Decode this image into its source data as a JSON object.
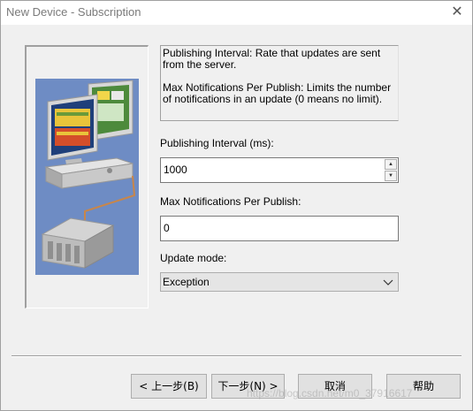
{
  "window": {
    "title": "New Device - Subscription",
    "close_glyph": "✕"
  },
  "description": {
    "line1": "Publishing Interval: Rate that updates are sent from the server.",
    "line2": "Max Notifications Per Publish: Limits the number of notifications in an update (0 means no limit)."
  },
  "publishing_interval": {
    "label": "Publishing Interval (ms):",
    "value": "1000"
  },
  "max_notifications": {
    "label": "Max Notifications Per Publish:",
    "value": "0"
  },
  "update_mode": {
    "label": "Update mode:",
    "selected": "Exception"
  },
  "buttons": {
    "back": "< 上一步(B)",
    "next": "下一步(N) >",
    "cancel": "取消",
    "help": "帮助"
  },
  "watermark": "https://blog.csdn.net/m0_37916617",
  "colors": {
    "illustration_bg": "#6e8cc4",
    "window_bg": "#f0f0f0"
  },
  "icons": {
    "close": "close-icon",
    "spin_up": "spin-up-icon",
    "spin_down": "spin-down-icon",
    "dropdown": "chevron-down-icon"
  }
}
